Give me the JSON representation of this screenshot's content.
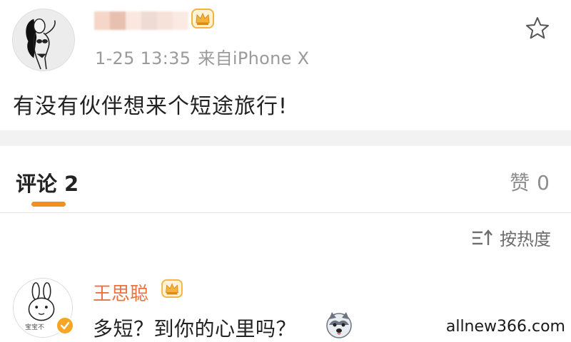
{
  "post": {
    "username_blurred": "",
    "timestamp": "1-25 13:35",
    "source": "来自iPhone X",
    "text": "有没有伙伴想来个短途旅行!",
    "icons": [
      "avatar",
      "crown-icon",
      "star-icon"
    ]
  },
  "comments_tab": {
    "label": "评论",
    "count": "2"
  },
  "likes_tab": {
    "label": "赞",
    "count": "0"
  },
  "sort": {
    "label": "按热度",
    "icon": "sort-icon"
  },
  "comment": {
    "author": "王思聪",
    "text": "多短？到你的心里吗？",
    "avatar_caption": "宝宝不",
    "icons": [
      "crown-icon",
      "verified-badge-icon",
      "husky-emoji-icon"
    ]
  },
  "watermark": "allnew366.com",
  "colors": {
    "accent_orange": "#f08f24",
    "author_name": "#eb7340",
    "meta_gray": "#9a9a9a",
    "band_gray": "#f2f2f2",
    "crown_gold": "#f3b33d"
  }
}
